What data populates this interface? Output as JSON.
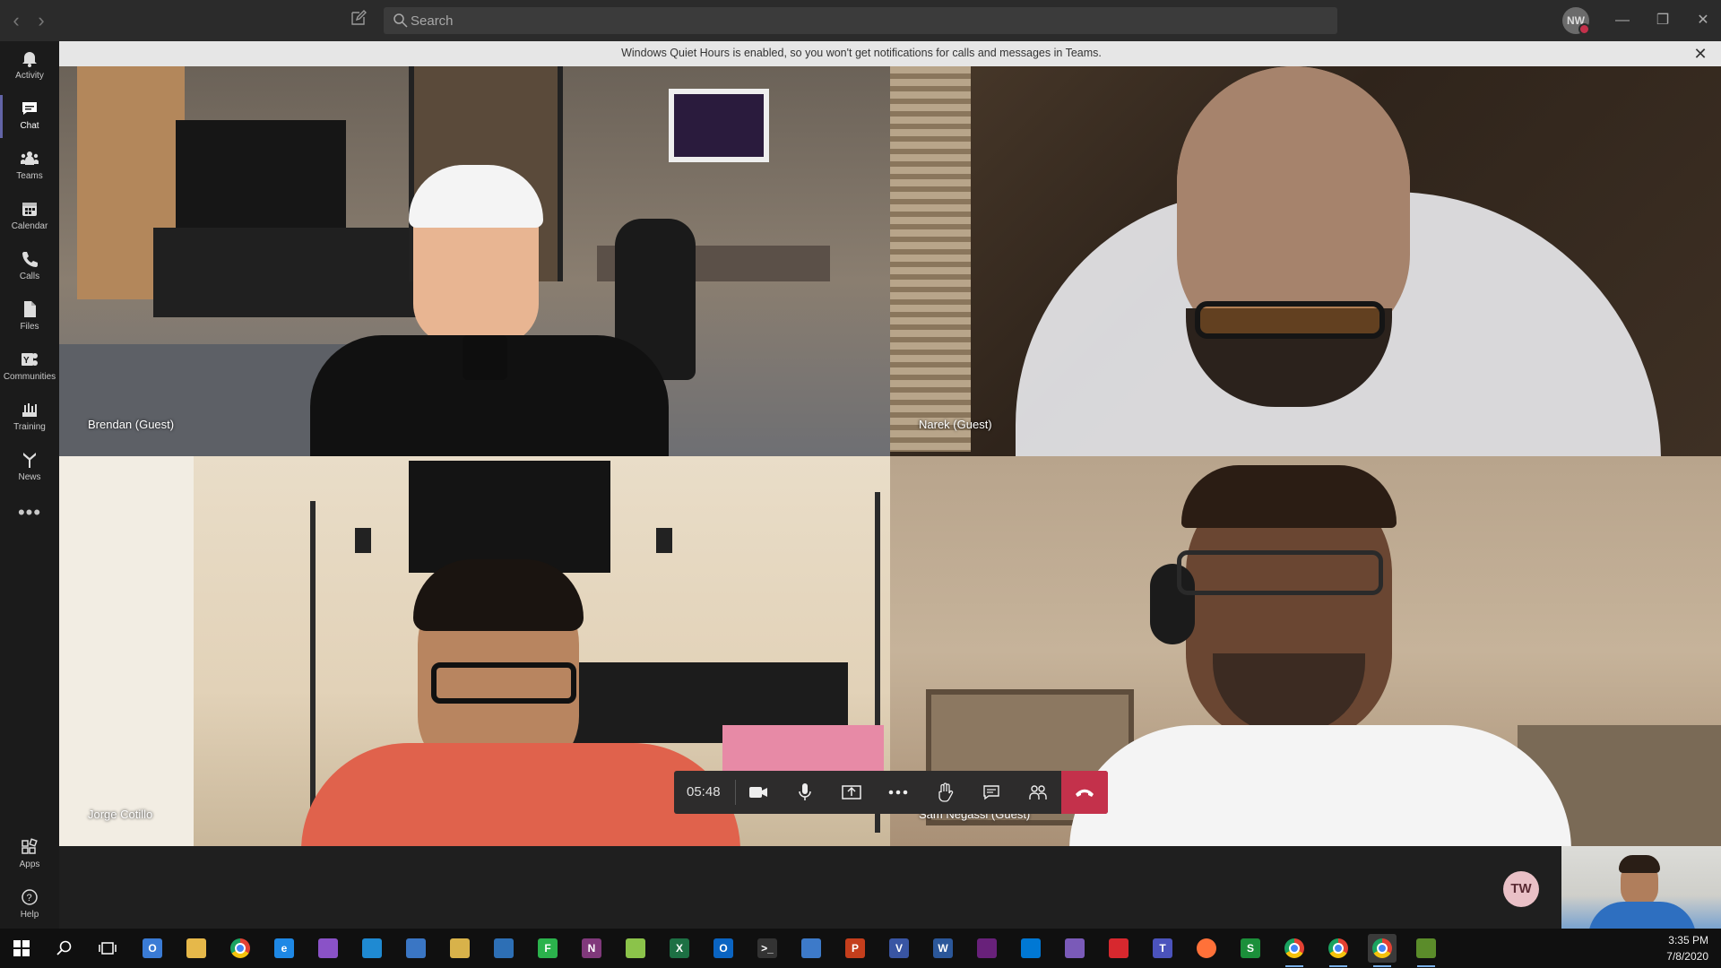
{
  "titlebar": {
    "back_glyph": "‹",
    "forward_glyph": "›",
    "compose_icon": "compose-icon",
    "search_placeholder": "Search",
    "user_initials": "NW",
    "minimize_glyph": "—",
    "restore_glyph": "❐",
    "close_glyph": "✕"
  },
  "rail": {
    "items": [
      {
        "label": "Activity",
        "icon": "bell-icon"
      },
      {
        "label": "Chat",
        "icon": "chat-icon",
        "active": true
      },
      {
        "label": "Teams",
        "icon": "teams-icon"
      },
      {
        "label": "Calendar",
        "icon": "calendar-icon"
      },
      {
        "label": "Calls",
        "icon": "phone-icon"
      },
      {
        "label": "Files",
        "icon": "files-icon"
      },
      {
        "label": "Communities",
        "icon": "communities-icon"
      },
      {
        "label": "Training",
        "icon": "training-icon"
      },
      {
        "label": "News",
        "icon": "news-icon"
      }
    ],
    "more_glyph": "•••",
    "bottom_items": [
      {
        "label": "Apps",
        "icon": "apps-icon"
      },
      {
        "label": "Help",
        "icon": "help-icon"
      }
    ]
  },
  "banner": {
    "message": "Windows Quiet Hours is enabled, so you won't get notifications for calls and messages in Teams.",
    "close_glyph": "✕"
  },
  "participants": [
    {
      "name": "Brendan (Guest)"
    },
    {
      "name": "Narek (Guest)"
    },
    {
      "name": "Jorge Cotillo"
    },
    {
      "name": "Sam Negassi (Guest)"
    }
  ],
  "callbar": {
    "duration": "05:48",
    "buttons": [
      "camera-icon",
      "microphone-icon",
      "share-screen-icon",
      "more-icon",
      "raise-hand-icon",
      "chat-icon",
      "participants-icon",
      "hang-up-icon"
    ]
  },
  "self": {
    "avatar_initials": "TW"
  },
  "taskbar": {
    "apps": [
      {
        "name": "outlook-alt",
        "glyph": "O",
        "color": "#3a7bd5"
      },
      {
        "name": "file-explorer",
        "glyph": "",
        "color": "#e6b84a"
      },
      {
        "name": "chrome",
        "glyph": "",
        "color": "#e34133"
      },
      {
        "name": "internet-explorer",
        "glyph": "e",
        "color": "#1e88e5"
      },
      {
        "name": "visual-studio",
        "glyph": "",
        "color": "#8a52c7"
      },
      {
        "name": "vs-code",
        "glyph": "",
        "color": "#1f8ad2"
      },
      {
        "name": "powershell",
        "glyph": "",
        "color": "#3a76c4"
      },
      {
        "name": "db-tool",
        "glyph": "",
        "color": "#d8b24a"
      },
      {
        "name": "network-tool",
        "glyph": "",
        "color": "#2d6fb5"
      },
      {
        "name": "feedly",
        "glyph": "F",
        "color": "#2bb24c"
      },
      {
        "name": "onenote",
        "glyph": "N",
        "color": "#80397b"
      },
      {
        "name": "notepad-plus",
        "glyph": "",
        "color": "#8bc34a"
      },
      {
        "name": "excel",
        "glyph": "X",
        "color": "#1d7044"
      },
      {
        "name": "outlook",
        "glyph": "O",
        "color": "#0a64c2"
      },
      {
        "name": "terminal",
        "glyph": ">_",
        "color": "#333333"
      },
      {
        "name": "remote-desktop",
        "glyph": "",
        "color": "#3d7ac9"
      },
      {
        "name": "powerpoint",
        "glyph": "P",
        "color": "#c43e1c"
      },
      {
        "name": "visio",
        "glyph": "V",
        "color": "#3955a3"
      },
      {
        "name": "word",
        "glyph": "W",
        "color": "#2b579a"
      },
      {
        "name": "visual-studio-2",
        "glyph": "",
        "color": "#68217a"
      },
      {
        "name": "skype-like",
        "glyph": "",
        "color": "#0078d4"
      },
      {
        "name": "screen-recorder",
        "glyph": "",
        "color": "#7a5ab8"
      },
      {
        "name": "acrobat",
        "glyph": "",
        "color": "#d7282e"
      },
      {
        "name": "teams",
        "glyph": "T",
        "color": "#4b53bc"
      },
      {
        "name": "firefox",
        "glyph": "",
        "color": "#ff7139"
      },
      {
        "name": "dollar-app",
        "glyph": "S",
        "color": "#1b8f3a"
      },
      {
        "name": "chrome-2",
        "glyph": "",
        "color": "#e34133"
      },
      {
        "name": "chrome-3",
        "glyph": "",
        "color": "#e34133"
      },
      {
        "name": "chrome-4",
        "glyph": "",
        "color": "#e34133"
      },
      {
        "name": "graph-app",
        "glyph": "",
        "color": "#5b8c2a"
      }
    ],
    "time": "3:35 PM",
    "date": "7/8/2020"
  },
  "colors": {
    "accent": "#6264a7",
    "hangup": "#c4314b",
    "banner_bg": "#e6e6e6"
  }
}
